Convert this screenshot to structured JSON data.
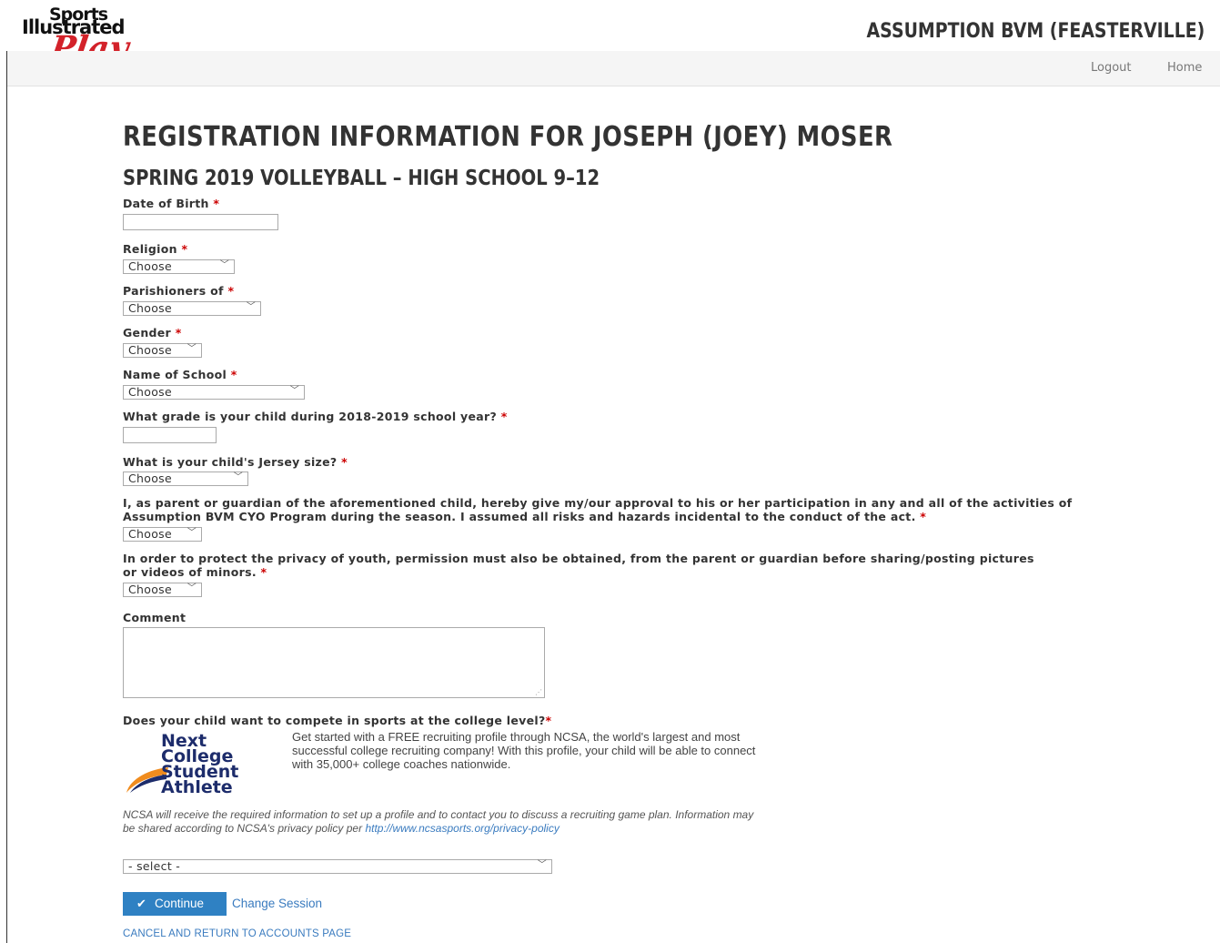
{
  "header": {
    "logo_line1": "Sports",
    "logo_line2": "Illustrated",
    "logo_line3": "Play",
    "org_title": "ASSUMPTION BVM (FEASTERVILLE)",
    "nav": {
      "logout": "Logout",
      "home": "Home"
    }
  },
  "page": {
    "title": "REGISTRATION INFORMATION FOR JOSEPH (JOEY) MOSER",
    "subtitle": "SPRING 2019 VOLLEYBALL – HIGH SCHOOL 9–12"
  },
  "required_mark": "*",
  "form": {
    "dob_label": "Date of Birth",
    "dob_value": "",
    "religion_label": "Religion",
    "religion_value": "Choose",
    "parish_label": "Parishioners of",
    "parish_value": "Choose",
    "gender_label": "Gender",
    "gender_value": "Choose",
    "school_label": "Name of School",
    "school_value": "Choose",
    "grade_label": "What grade is your child during 2018-2019 school year?",
    "grade_value": "",
    "jersey_label": "What is your child's Jersey size?",
    "jersey_value": "Choose",
    "consent_label": "I, as parent or guardian of the aforementioned child, hereby give my/our approval to his or her participation in any and all of the activities of Assumption BVM CYO Program during the season. I assumed all risks and hazards incidental to the conduct of the act.",
    "consent_value": "Choose",
    "privacy_label": "In order to protect the privacy of youth, permission must also be obtained, from the parent or guardian before sharing/posting pictures or videos of minors.",
    "privacy_value": "Choose",
    "comment_label": "Comment",
    "comment_value": "",
    "college_label": "Does your child want to compete in sports at the college level?",
    "college_value": "- select -"
  },
  "ncsa": {
    "logo_lines": [
      "Next",
      "College",
      "Student",
      "Athlete"
    ],
    "description": "Get started with a FREE recruiting profile through NCSA, the world's largest and most successful college recruiting company! With this profile, your child will be able to connect with 35,000+ college coaches nationwide.",
    "note": "NCSA will receive the required information to set up a profile and to contact you to discuss a recruiting game plan. Information may be shared according to NCSA's privacy policy per",
    "policy_link": "http://www.ncsasports.org/privacy-policy"
  },
  "actions": {
    "continue": "Continue",
    "change_session": "Change Session",
    "cancel": "CANCEL AND RETURN TO ACCOUNTS PAGE"
  },
  "colors": {
    "accent": "#2f81c3",
    "link": "#3a7bbf",
    "required": "#cc0000",
    "logo_red": "#d3222a",
    "ncsa_navy": "#1d2c6b",
    "ncsa_orange": "#f08c1e"
  },
  "icons": {
    "continue": "check-icon",
    "select": "chevron-down-icon"
  }
}
